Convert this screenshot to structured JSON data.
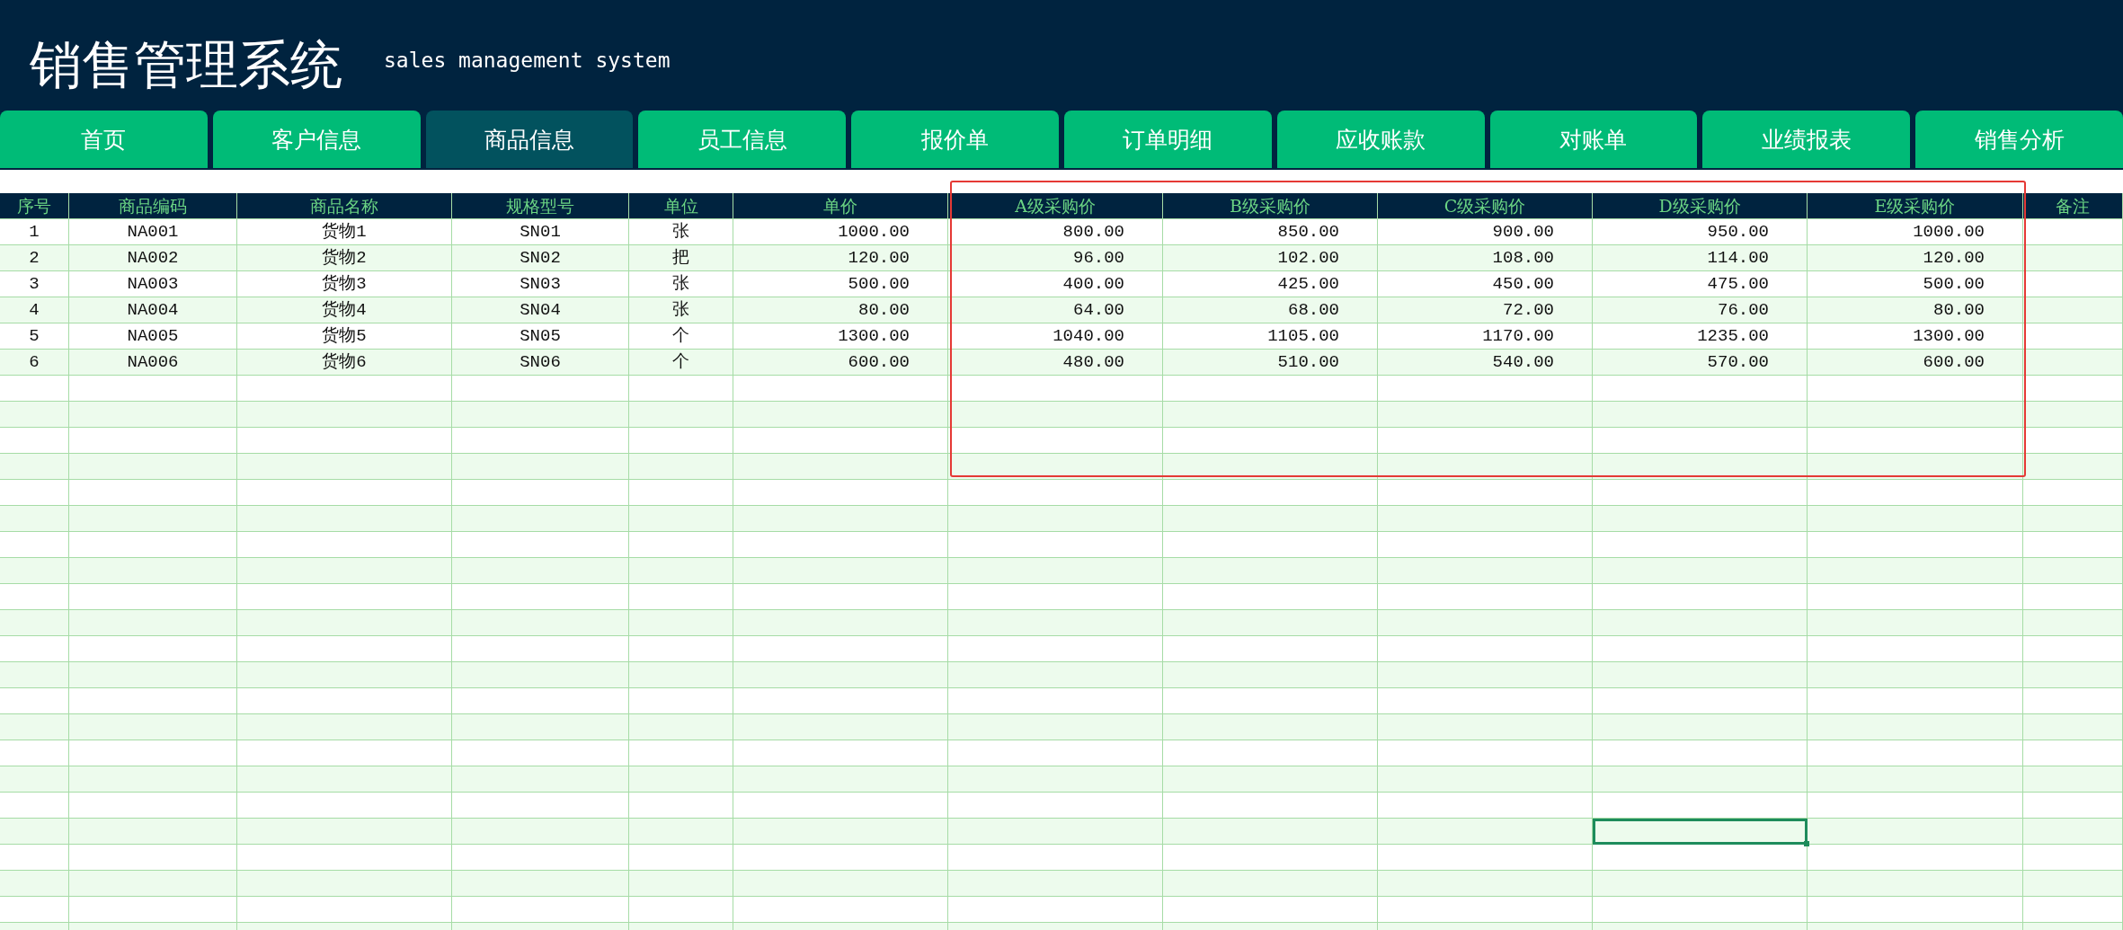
{
  "header": {
    "title": "销售管理系统",
    "subtitle": "sales management system"
  },
  "tabs": [
    {
      "label": "首页",
      "selected": false
    },
    {
      "label": "客户信息",
      "selected": false
    },
    {
      "label": "商品信息",
      "selected": true
    },
    {
      "label": "员工信息",
      "selected": false
    },
    {
      "label": "报价单",
      "selected": false
    },
    {
      "label": "订单明细",
      "selected": false
    },
    {
      "label": "应收账款",
      "selected": false
    },
    {
      "label": "对账单",
      "selected": false
    },
    {
      "label": "业绩报表",
      "selected": false
    },
    {
      "label": "销售分析",
      "selected": false
    }
  ],
  "table": {
    "columns": [
      {
        "label": "序号",
        "kind": "center"
      },
      {
        "label": "商品编码",
        "kind": "center"
      },
      {
        "label": "商品名称",
        "kind": "center"
      },
      {
        "label": "规格型号",
        "kind": "center"
      },
      {
        "label": "单位",
        "kind": "center"
      },
      {
        "label": "单价",
        "kind": "number"
      },
      {
        "label": "A级采购价",
        "kind": "number"
      },
      {
        "label": "B级采购价",
        "kind": "number"
      },
      {
        "label": "C级采购价",
        "kind": "number"
      },
      {
        "label": "D级采购价",
        "kind": "number"
      },
      {
        "label": "E级采购价",
        "kind": "number"
      },
      {
        "label": "备注",
        "kind": "center"
      }
    ],
    "rows": [
      {
        "cells": [
          "1",
          "NA001",
          "货物1",
          "SN01",
          "张",
          "1000.00",
          "800.00",
          "850.00",
          "900.00",
          "950.00",
          "1000.00"
        ]
      },
      {
        "cells": [
          "2",
          "NA002",
          "货物2",
          "SN02",
          "把",
          "120.00",
          "96.00",
          "102.00",
          "108.00",
          "114.00",
          "120.00"
        ]
      },
      {
        "cells": [
          "3",
          "NA003",
          "货物3",
          "SN03",
          "张",
          "500.00",
          "400.00",
          "425.00",
          "450.00",
          "475.00",
          "500.00"
        ]
      },
      {
        "cells": [
          "4",
          "NA004",
          "货物4",
          "SN04",
          "张",
          "80.00",
          "64.00",
          "68.00",
          "72.00",
          "76.00",
          "80.00"
        ]
      },
      {
        "cells": [
          "5",
          "NA005",
          "货物5",
          "SN05",
          "个",
          "1300.00",
          "1040.00",
          "1105.00",
          "1170.00",
          "1235.00",
          "1300.00"
        ]
      },
      {
        "cells": [
          "6",
          "NA006",
          "货物6",
          "SN06",
          "个",
          "600.00",
          "480.00",
          "510.00",
          "540.00",
          "570.00",
          "600.00"
        ]
      }
    ],
    "blank_rows": [
      {},
      {},
      {},
      {},
      {},
      {},
      {},
      {},
      {},
      {},
      {},
      {},
      {},
      {},
      {},
      {},
      {},
      {
        "cells": [
          {
            "selected": false
          },
          {
            "selected": false
          },
          {
            "selected": false
          },
          {
            "selected": false
          },
          {
            "selected": false
          },
          {
            "selected": false
          },
          {
            "selected": false
          },
          {
            "selected": false
          },
          {
            "selected": false
          },
          {
            "selected": true
          },
          {
            "selected": false
          },
          {
            "selected": false
          }
        ]
      },
      {},
      {},
      {},
      {}
    ]
  }
}
